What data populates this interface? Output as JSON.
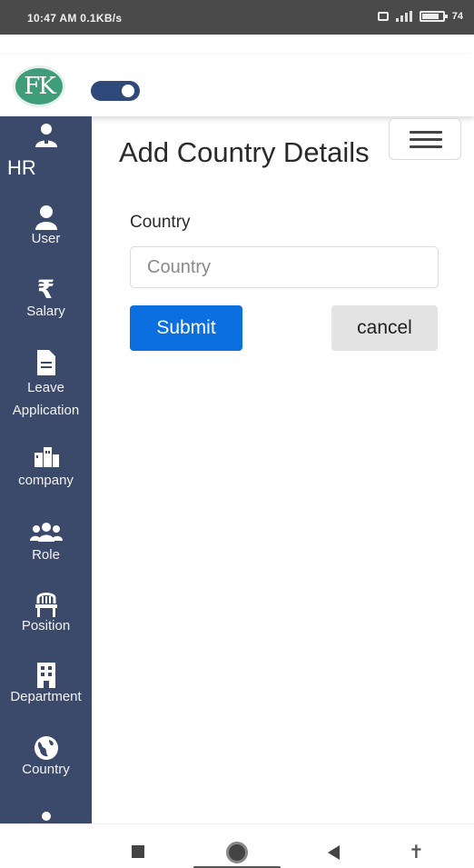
{
  "status_bar": {
    "time_info": "10:47 AM 0.1KB/s",
    "battery": "74"
  },
  "navbar": {
    "logo_text": "FK"
  },
  "sidebar": {
    "header_label": "HR",
    "items": [
      {
        "label": "User",
        "icon": "user-icon"
      },
      {
        "label": "Salary",
        "icon": "rupee-icon"
      },
      {
        "label": "Leave Application",
        "icon": "document-icon"
      },
      {
        "label": "company",
        "icon": "buildings-icon"
      },
      {
        "label": "Role",
        "icon": "users-icon"
      },
      {
        "label": "Position",
        "icon": "chair-icon"
      },
      {
        "label": "Department",
        "icon": "building-icon"
      },
      {
        "label": "Country",
        "icon": "globe-icon"
      }
    ]
  },
  "form": {
    "title": "Add Country Details",
    "country_label": "Country",
    "country_placeholder": "Country",
    "country_value": "",
    "submit_label": "Submit",
    "cancel_label": "cancel"
  },
  "colors": {
    "sidebar_bg": "#3b4a6b",
    "primary_button": "#0b6fe0",
    "logo_green": "#3f9d79"
  }
}
